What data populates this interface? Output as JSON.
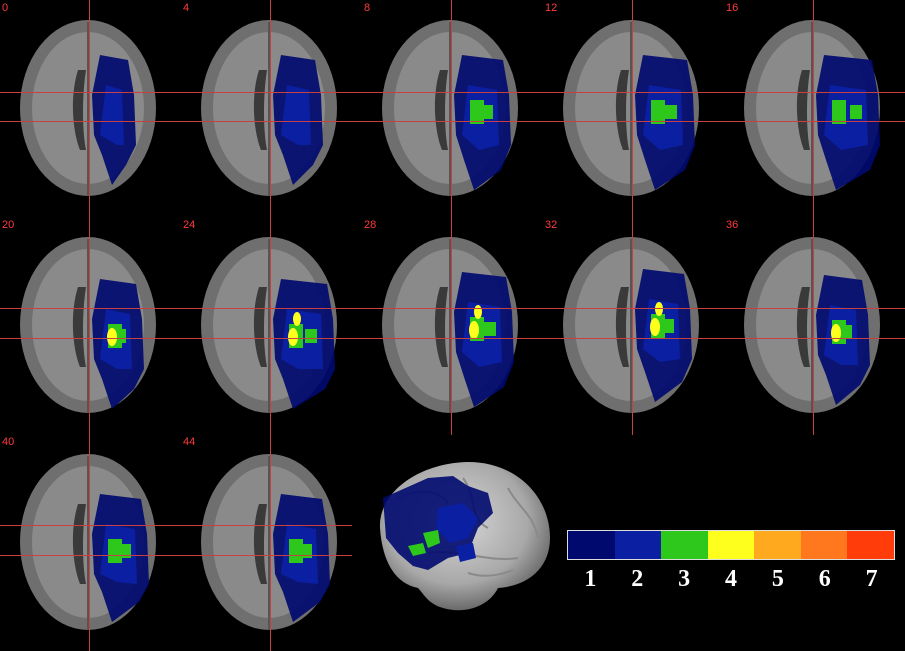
{
  "slices": [
    {
      "label": "0"
    },
    {
      "label": "4"
    },
    {
      "label": "8"
    },
    {
      "label": "12"
    },
    {
      "label": "16"
    },
    {
      "label": "20"
    },
    {
      "label": "24"
    },
    {
      "label": "28"
    },
    {
      "label": "32"
    },
    {
      "label": "36"
    },
    {
      "label": "40"
    },
    {
      "label": "44"
    }
  ],
  "colorbar": {
    "colors": [
      "#000a6e",
      "#0b1fa3",
      "#2ec81c",
      "#ffff1e",
      "#ffaa1e",
      "#ff781e",
      "#ff3c0a"
    ],
    "labels": [
      "1",
      "2",
      "3",
      "4",
      "5",
      "6",
      "7"
    ]
  }
}
